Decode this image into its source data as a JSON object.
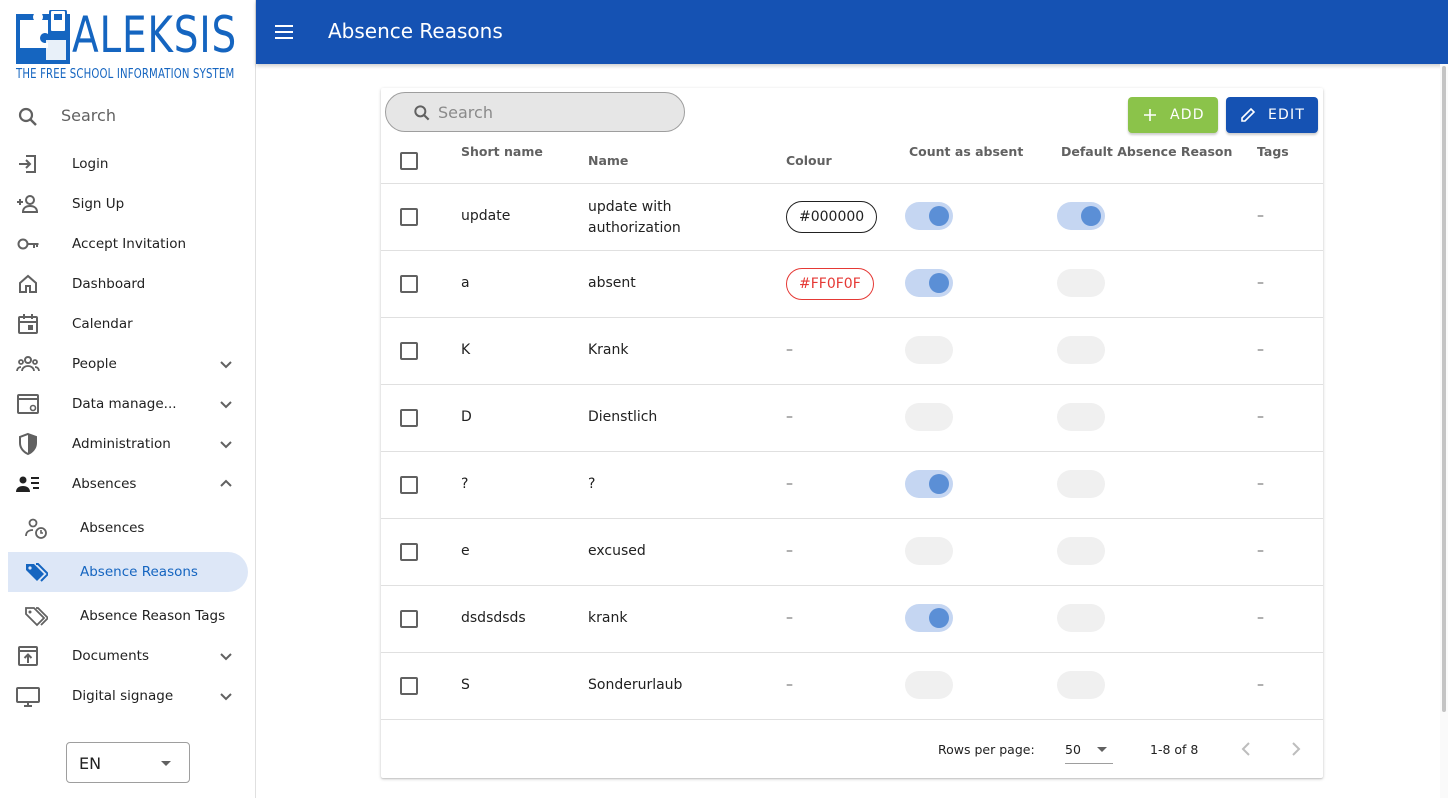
{
  "logo": {
    "title": "ALEKSIS",
    "subtitle": "THE FREE SCHOOL INFORMATION SYSTEM"
  },
  "sidebar": {
    "search_placeholder": "Search",
    "items": [
      {
        "label": "Login",
        "icon": "login-icon"
      },
      {
        "label": "Sign Up",
        "icon": "person-add-icon"
      },
      {
        "label": "Accept Invitation",
        "icon": "key-icon"
      },
      {
        "label": "Dashboard",
        "icon": "home-icon"
      },
      {
        "label": "Calendar",
        "icon": "calendar-icon"
      },
      {
        "label": "People",
        "icon": "people-icon",
        "expandable": true
      },
      {
        "label": "Data manage...",
        "icon": "data-management-icon",
        "expandable": true
      },
      {
        "label": "Administration",
        "icon": "shield-icon",
        "expandable": true
      },
      {
        "label": "Absences",
        "icon": "absences-icon",
        "expandable": true,
        "expanded": true
      },
      {
        "label": "Absences",
        "icon": "person-clock-icon",
        "sub": true
      },
      {
        "label": "Absence Reasons",
        "icon": "tags-icon",
        "sub": true,
        "active": true
      },
      {
        "label": "Absence Reason Tags",
        "icon": "tags-outline-icon",
        "sub": true
      },
      {
        "label": "Documents",
        "icon": "document-upload-icon",
        "expandable": true
      },
      {
        "label": "Digital signage",
        "icon": "monitor-icon",
        "expandable": true
      }
    ],
    "language": "EN"
  },
  "appbar": {
    "title": "Absence Reasons"
  },
  "table": {
    "search_placeholder": "Search",
    "add_label": "ADD",
    "edit_label": "EDIT",
    "columns": [
      "Short name",
      "Name",
      "Colour",
      "Count as absent",
      "Default Absence Reason",
      "Tags"
    ],
    "rows": [
      {
        "short_name": "update",
        "name": "update with authorization",
        "colour": "#000000",
        "colour_hex": "#000000",
        "count_as_absent": true,
        "default": true,
        "tags": "–"
      },
      {
        "short_name": "a",
        "name": "absent",
        "colour": "#FF0F0F",
        "colour_hex": "#e53935",
        "count_as_absent": true,
        "default": false,
        "tags": "–"
      },
      {
        "short_name": "K",
        "name": "Krank",
        "colour": "–",
        "count_as_absent": false,
        "default": false,
        "tags": "–"
      },
      {
        "short_name": "D",
        "name": "Dienstlich",
        "colour": "–",
        "count_as_absent": false,
        "default": false,
        "tags": "–"
      },
      {
        "short_name": "?",
        "name": "?",
        "colour": "–",
        "count_as_absent": true,
        "default": false,
        "tags": "–"
      },
      {
        "short_name": "e",
        "name": "excused",
        "colour": "–",
        "count_as_absent": false,
        "default": false,
        "tags": "–"
      },
      {
        "short_name": "dsdsdsds",
        "name": "krank",
        "colour": "–",
        "count_as_absent": true,
        "default": false,
        "tags": "–"
      },
      {
        "short_name": "S",
        "name": "Sonderurlaub",
        "colour": "–",
        "count_as_absent": false,
        "default": false,
        "tags": "–"
      }
    ],
    "footer": {
      "rows_per_page_label": "Rows per page:",
      "rows_per_page": "50",
      "range": "1-8 of 8"
    }
  },
  "colors": {
    "primary": "#1552b3",
    "add_button": "#8bc34a",
    "active_nav_bg": "#dde7f7"
  }
}
